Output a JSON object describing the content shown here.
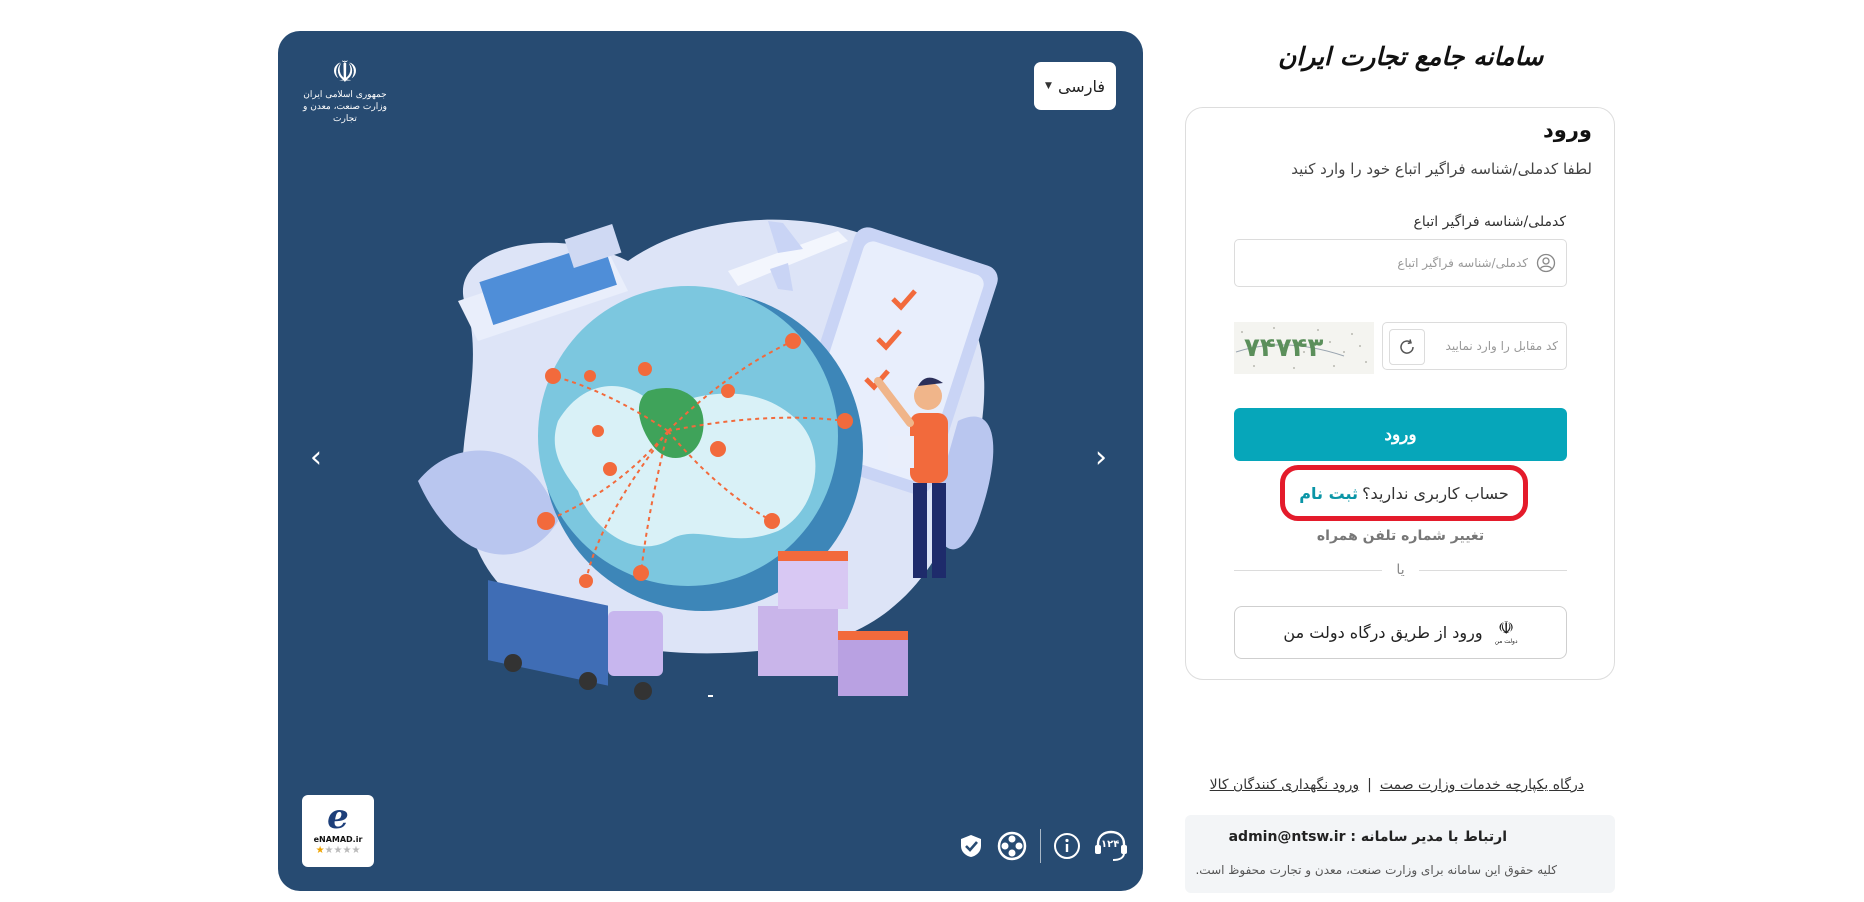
{
  "hero": {
    "language": "فارسی",
    "ministry_logo_line1": "جمهوری اسلامی ایران",
    "ministry_logo_line2": "وزارت صنعت، معدن و تجارت",
    "enamad": {
      "site": "eNAMAD.ir",
      "stars_filled": 1,
      "stars_total": 5
    },
    "footer_icons": [
      "support-124-icon",
      "info-icon",
      "film-reel-icon",
      "shield-check-icon"
    ],
    "support_number": "۱۲۴",
    "bg_color": "#274b72"
  },
  "brand": {
    "title": "سامانه جامع تجارت ایران"
  },
  "login": {
    "title": "ورود",
    "subtitle": "لطفا کدملی/شناسه فراگیر اتباع خود را وارد کنید",
    "id_label": "کدملی/شناسه فراگیر اتباع",
    "id_placeholder": "کدملی/شناسه فراگیر اتباع",
    "id_value": "",
    "captcha_placeholder": "کد مقابل را وارد نمایید",
    "captcha_value": "",
    "captcha_image_text": "۷۴۷۴۳",
    "submit_label": "ورود",
    "no_account_text": "حساب کاربری ندارید؟",
    "register_label": "ثبت نام",
    "change_phone_label": "تغییر شماره تلفن همراه",
    "or_text": "یا",
    "gov_login_label": "ورود از طریق درگاه دولت من",
    "accent_color": "#06a6ba",
    "highlight_color": "#e41b2b"
  },
  "footer": {
    "link_portal": "درگاه یکپارچه خدمات وزارت صمت",
    "link_warehouse": "ورود نگهداری کنندگان کالا",
    "contact": "ارتباط با مدیر سامانه : admin@ntsw.ir",
    "copyright": "کلیه حقوق این سامانه برای وزارت صنعت، معدن و تجارت محفوظ است."
  }
}
